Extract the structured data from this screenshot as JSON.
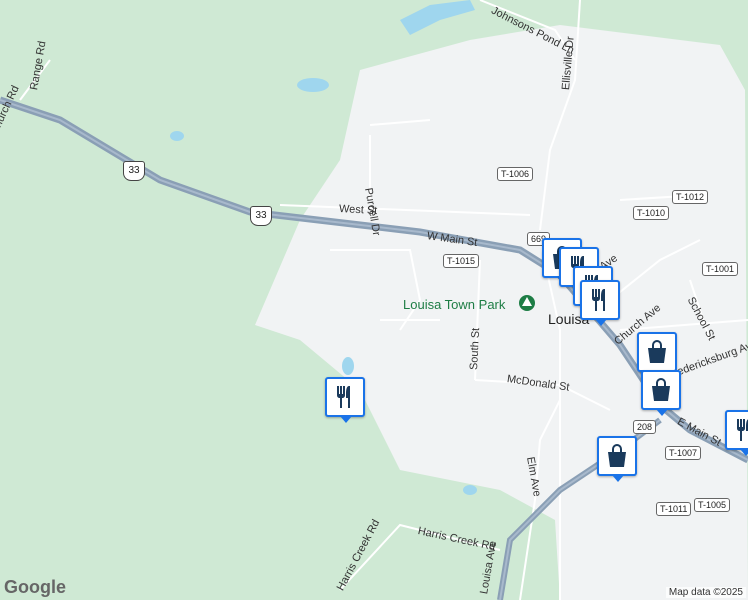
{
  "roads": {
    "range_rd": "Range Rd",
    "johnsons_pond_ln": "Johnsons Pond Ln",
    "ellisville_dr": "Ellisville Dr",
    "purcell_dr": "Purcell Dr",
    "west_st": "West St",
    "w_main_st": "W Main St",
    "south_st": "South St",
    "mcdonald_st": "McDonald St",
    "elm_ave": "Elm Ave",
    "church_ave": "Church Ave",
    "school_st": "School St",
    "fredericksburg_ave": "Fredericksburg Ave",
    "e_main_st": "E Main St",
    "harris_creek_rd_1": "Harris Creek Rd",
    "harris_creek_rd_2": "Harris Creek Rd",
    "louisa_ave": "Louisa Ave",
    "church_rd_partial": "Church Rd",
    "ave_partial": "Ave"
  },
  "shields": {
    "us33_a": "33",
    "us33_b": "33",
    "r669": "669",
    "t1006": "T-1006",
    "t1015": "T-1015",
    "t1012": "T-1012",
    "t1010": "T-1010",
    "t1001": "T-1001",
    "r208": "208",
    "t1007": "T-1007",
    "t1011": "T-1011",
    "t1005": "T-1005"
  },
  "places": {
    "town": "Louisa",
    "park": "Louisa Town Park"
  },
  "pois": [
    {
      "type": "restaurant"
    },
    {
      "type": "shopping"
    },
    {
      "type": "restaurant"
    },
    {
      "type": "restaurant"
    },
    {
      "type": "restaurant"
    },
    {
      "type": "shopping"
    },
    {
      "type": "shopping"
    },
    {
      "type": "restaurant"
    },
    {
      "type": "shopping"
    },
    {
      "type": "restaurant"
    }
  ],
  "colors": {
    "forest": "#cfe9d4",
    "urban": "#f1f3f4",
    "water": "#9fd6ee",
    "highway": "#8a9fb5",
    "poi_border": "#1a73e8"
  },
  "footer": {
    "logo": "Google",
    "attribution": "Map data ©2025"
  }
}
